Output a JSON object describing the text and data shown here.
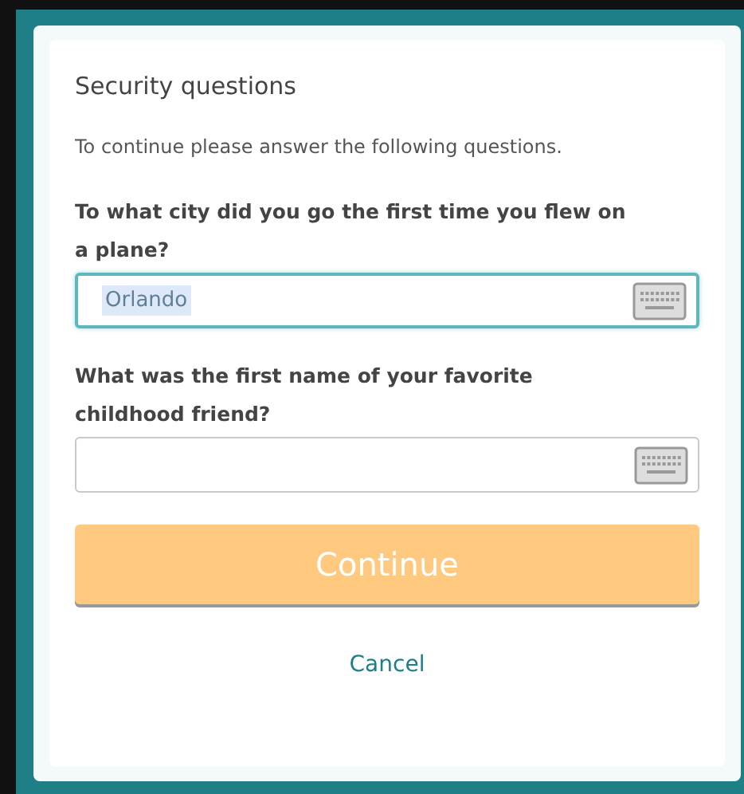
{
  "dialog": {
    "title": "Security questions",
    "intro": "To continue please answer the following questions.",
    "questions": [
      {
        "label": "To what city did you go the first time you flew on a plane?",
        "value": "Orlando",
        "focused": true,
        "value_highlighted": true
      },
      {
        "label": "What was the first name of your favorite childhood friend?",
        "focused": false
      }
    ],
    "continue_button": {
      "label": "Continue",
      "disabled": true
    },
    "cancel_link": "Cancel"
  }
}
